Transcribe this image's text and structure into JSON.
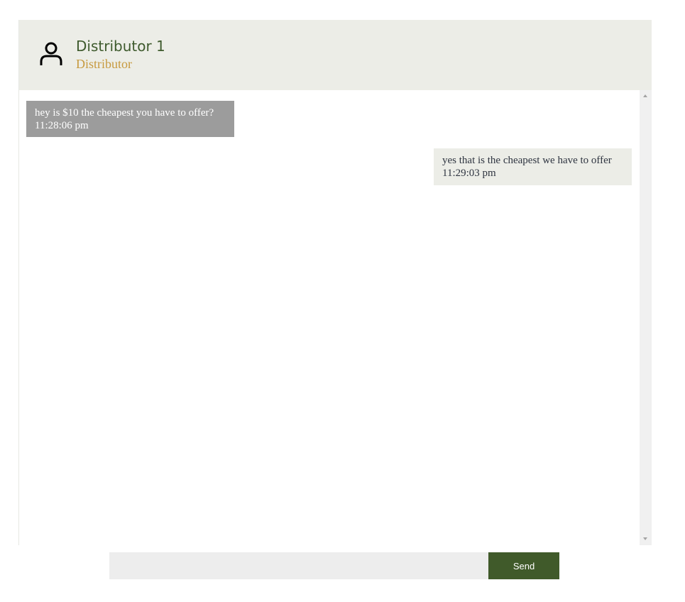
{
  "header": {
    "name": "Distributor 1",
    "role": "Distributor",
    "avatar_icon": "user-icon"
  },
  "messages": [
    {
      "direction": "incoming",
      "text": "hey is $10 the cheapest you have to offer?",
      "time": "11:28:06 pm"
    },
    {
      "direction": "outgoing",
      "text": "yes that is the cheapest we have to offer",
      "time": "11:29:03 pm"
    }
  ],
  "composer": {
    "value": "",
    "placeholder": "",
    "send_label": "Send"
  },
  "colors": {
    "header_bg": "#ecede7",
    "name_color": "#3e5a2d",
    "role_color": "#c79a3f",
    "incoming_bubble": "#9c9c9c",
    "outgoing_bubble": "#ecede7",
    "send_button": "#405a2a"
  }
}
